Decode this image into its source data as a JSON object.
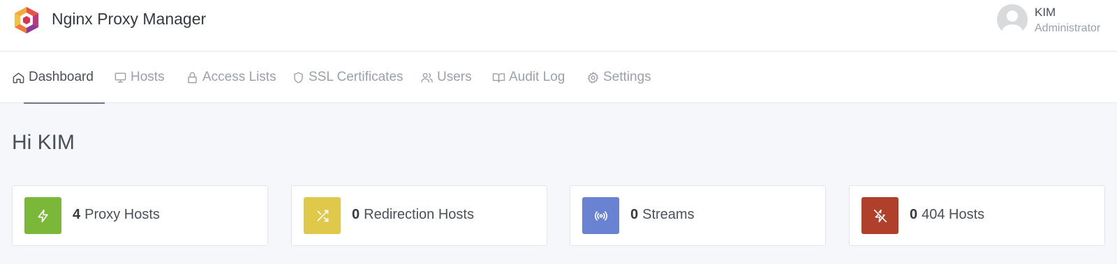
{
  "app": {
    "title": "Nginx Proxy Manager",
    "logo_icon": "nginx-proxy-manager-logo"
  },
  "user": {
    "name": "KIM",
    "role": "Administrator",
    "avatar_icon": "user-avatar-icon"
  },
  "nav": {
    "items": [
      {
        "label": "Dashboard",
        "icon": "home-icon",
        "active": true
      },
      {
        "label": "Hosts",
        "icon": "monitor-icon",
        "active": false
      },
      {
        "label": "Access Lists",
        "icon": "lock-icon",
        "active": false
      },
      {
        "label": "SSL Certificates",
        "icon": "shield-icon",
        "active": false
      },
      {
        "label": "Users",
        "icon": "users-icon",
        "active": false
      },
      {
        "label": "Audit Log",
        "icon": "book-icon",
        "active": false
      },
      {
        "label": "Settings",
        "icon": "gear-icon",
        "active": false
      }
    ]
  },
  "dashboard": {
    "greeting": "Hi KIM",
    "cards": [
      {
        "count": "4",
        "label": "Proxy Hosts",
        "icon": "zap-icon",
        "color": "#7bb839"
      },
      {
        "count": "0",
        "label": "Redirection Hosts",
        "icon": "shuffle-icon",
        "color": "#e0c84a"
      },
      {
        "count": "0",
        "label": "Streams",
        "icon": "radio-icon",
        "color": "#6982d2"
      },
      {
        "count": "0",
        "label": "404 Hosts",
        "icon": "zap-off-icon",
        "color": "#b0402a"
      }
    ]
  }
}
